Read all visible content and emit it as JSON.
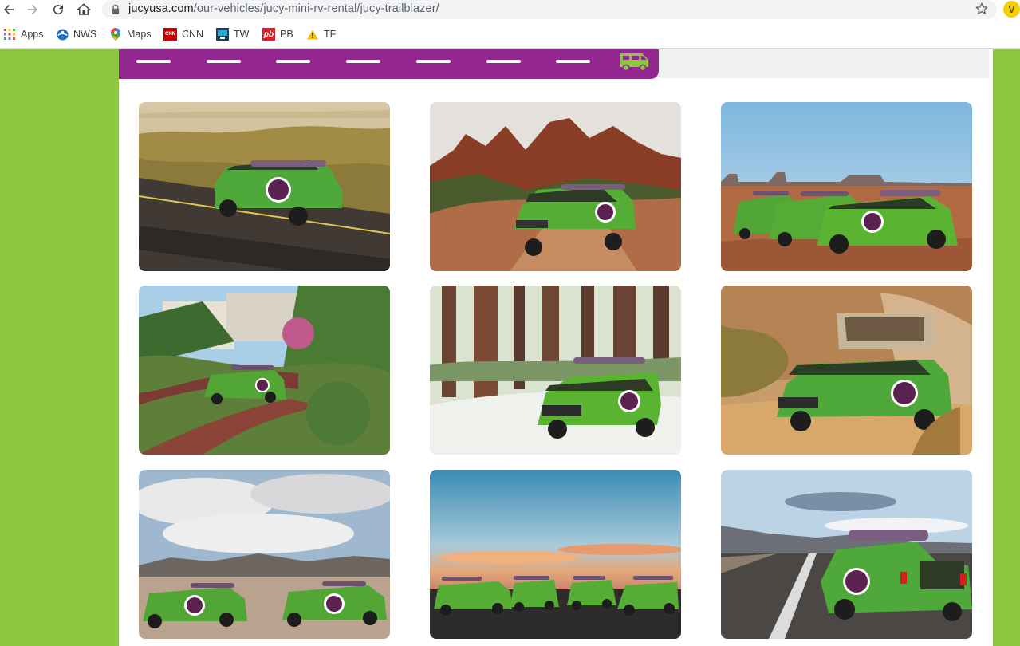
{
  "browser": {
    "url_host": "jucyusa.com",
    "url_path": "/our-vehicles/jucy-mini-rv-rental/jucy-trailblazer/",
    "extension_letter": "V",
    "icons": [
      "back-icon",
      "forward-icon",
      "reload-icon",
      "home-icon",
      "lock-icon",
      "star-icon"
    ]
  },
  "bookmarks": [
    {
      "label": "Apps",
      "icon": "apps-grid-icon"
    },
    {
      "label": "NWS",
      "icon": "nws-icon"
    },
    {
      "label": "Maps",
      "icon": "maps-pin-icon"
    },
    {
      "label": "CNN",
      "icon": "cnn-icon",
      "badge": "CNN"
    },
    {
      "label": "TW",
      "icon": "tw-icon"
    },
    {
      "label": "PB",
      "icon": "pb-icon",
      "badge": "pb"
    },
    {
      "label": "TF",
      "icon": "warning-icon"
    }
  ],
  "colors": {
    "brand_green": "#8dc63f",
    "brand_purple": "#93278f",
    "van_green": "#5ab432",
    "van_purple": "#5b2150"
  },
  "road_banner": {
    "icon": "van-icon",
    "dash_count": 7
  },
  "gallery": {
    "photos": [
      {
        "scene": "desert-road-single-van",
        "icon": "photo"
      },
      {
        "scene": "red-rock-canyon-van",
        "icon": "photo"
      },
      {
        "scene": "monument-valley-three-vans",
        "icon": "photo"
      },
      {
        "scene": "lombard-street-van",
        "icon": "photo"
      },
      {
        "scene": "redwood-forest-van",
        "icon": "photo"
      },
      {
        "scene": "rock-outcrop-van-rooftop-tent",
        "icon": "photo"
      },
      {
        "scene": "cloudy-desert-two-vans",
        "icon": "photo"
      },
      {
        "scene": "sunset-four-vans",
        "icon": "photo"
      },
      {
        "scene": "highway-van-rear-view",
        "icon": "photo"
      }
    ]
  }
}
